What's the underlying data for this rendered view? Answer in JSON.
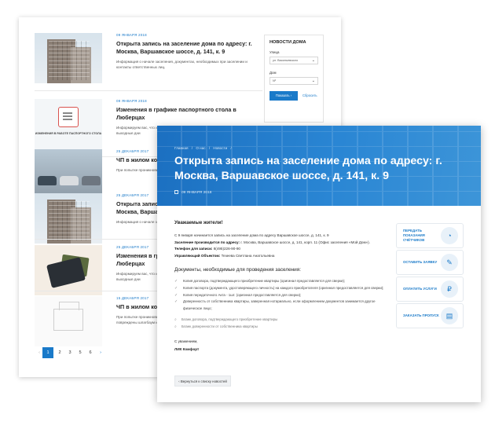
{
  "colors": {
    "accent": "#1a7ac9",
    "hero": "#2a86d4"
  },
  "list": {
    "items": [
      {
        "date": "09 ЯНВАРЯ 2018",
        "title": "Открыта запись на заселение дома по адресу: г. Москва, Варшавское шоссе, д. 141, к. 9",
        "desc": "Информация о начале заселения, документах, необходимых при заселении и контакты ответственных лиц."
      },
      {
        "date": "09 ЯНВАРЯ 2018",
        "title": "Изменения в графике паспортного стола в Люберцах",
        "desc": "Информируем вас, что изменён график работы паспортного стола в Люберцах в выходные дни",
        "img_caption": "ИЗМЕНЕНИЯ В РАБОТЕ ПАСПОРТНОГО СТОЛА"
      },
      {
        "date": "25 ДЕКАБРЯ 2017",
        "title": "ЧП в жилом комплексе «Манхэттен»",
        "desc": "При попытке проникновения на территорию жилого комплекса автомобилистом"
      },
      {
        "date": "25 ДЕКАБРЯ 2017",
        "title": "Открыта запись на заселение дома по адресу: г. Москва, Варшавское шоссе, д. 141, к. 9",
        "desc": "Информация о начале заселения, документах, необходимых при заселении"
      },
      {
        "date": "25 ДЕКАБРЯ 2017",
        "title": "Изменения в графике паспортного стола в Люберцах",
        "desc": "Информируем вас, что изменён график работы паспортного стола в Люберцах в выходные дни"
      },
      {
        "date": "15 ДЕКАБРЯ 2017",
        "title": "ЧП в жилом комплексе «Манхэттен»",
        "desc": "При попытке проникновения на территорию жилого комплекса автомобилистом были повреждены шлагбаум и ограждение"
      }
    ],
    "pagination": {
      "prev": "‹",
      "pages": [
        "1",
        "2",
        "3",
        "5",
        "6"
      ],
      "next": "›"
    }
  },
  "filter": {
    "title": "НОВОСТИ ДОМА",
    "street_label": "Улица",
    "street_value": "ул. Васильевского",
    "house_label": "Дом",
    "house_value": "Nº",
    "show_button": "Показать  ›",
    "reset_link": "Сбросить"
  },
  "article": {
    "breadcrumbs": [
      "Главная",
      "/",
      "О нас",
      "/",
      "Новости",
      "/"
    ],
    "title": "Открыта запись на заселение дома по адресу: г. Москва, Варшавское шоссе, д. 141, к. 9",
    "date": "09 ЯНВАРЯ 2018",
    "greeting": "Уважаемые жители!",
    "p1": "С 9 января начинается запись на заселение дома по адресу Варшавское шоссе, д. 141, к. 9",
    "p2_label": "Заселение производится по адресу:",
    "p2_value": " г. Москва, Варшавское шоссе, д. 141, корп. 11 (Офис заселения «Мой Дом»).",
    "p3_label": "Телефон для записи:",
    "p3_value": " 8(495)226-90-90",
    "p4_label": "Управляющий Объектом:",
    "p4_value": " Тезеева Светлана Анатольевна",
    "docs_heading": "Документы, необходимые для проведения заселения:",
    "docs": [
      "Копия договора, подтверждающего приобретение квартиры (оригинал предоставляется для сверки);",
      "Копия паспорта (документа, удостоверяющего личность) на каждого приобретателя (оригинал предоставляется для сверки);",
      "Копия передаточного Акта - 1шт. (оригинал предоставляется для сверки);",
      "Доверенность от собственника квартиры, заверенная нотариально, если оформлением документов занимается другое физическое лицо;"
    ],
    "links": [
      "Бланк договора, подтверждающего приобретение квартиры",
      "Бланк доверенности от собственника квартиры"
    ],
    "sign_1": "С уважением,",
    "sign_2": "ЛИК Комфорт",
    "back_button": "‹  Вернуться к списку новостей"
  },
  "services": [
    {
      "label": "ПЕРЕДАТЬ ПОКАЗАНИЯ СЧЁТЧИКОВ",
      "icon": "meter-icon",
      "glyph": "◔"
    },
    {
      "label": "ОСТАВИТЬ ЗАЯВКУ",
      "icon": "clipboard-icon",
      "glyph": "✎"
    },
    {
      "label": "ОПЛАТИТЬ УСЛУГИ",
      "icon": "payment-icon",
      "glyph": "₽"
    },
    {
      "label": "ЗАКАЗАТЬ ПРОПУСК",
      "icon": "pass-icon",
      "glyph": "▤"
    }
  ]
}
